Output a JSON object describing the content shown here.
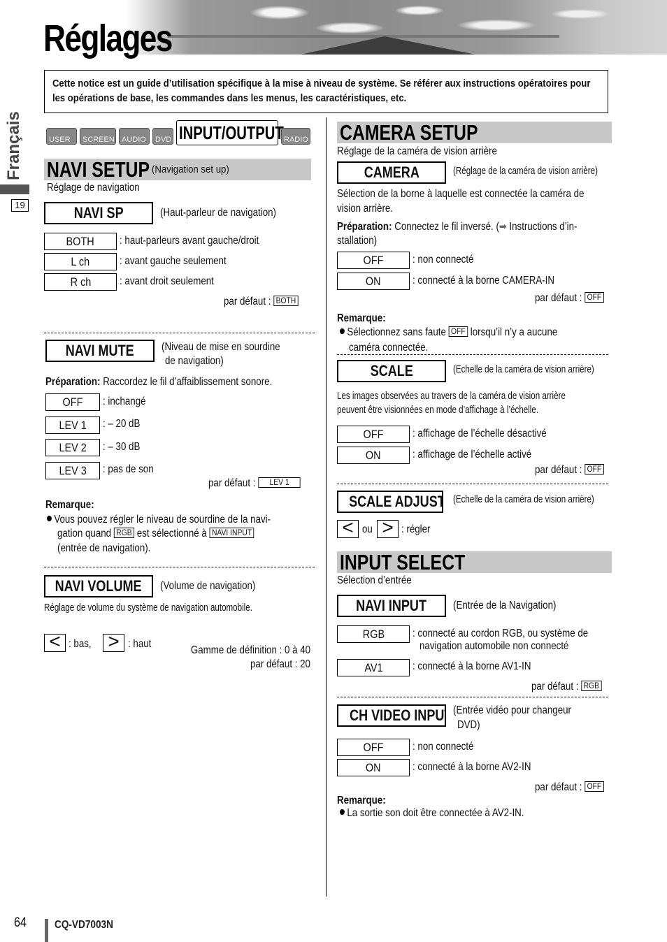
{
  "page": {
    "title": "Réglages",
    "intro": "Cette notice est un guide d’utilisation spécifique à la mise à niveau de système. Se référer aux instructions opératoires pour les opérations de base, les commandes dans les menus, les caractéristiques, etc.",
    "side_language": "Français",
    "side_number": "19",
    "page_number": "64",
    "model": "CQ-VD7003N"
  },
  "mode_tabs": [
    {
      "label": "USER",
      "active": false
    },
    {
      "label": "SCREEN",
      "active": false
    },
    {
      "label": "AUDIO",
      "active": false
    },
    {
      "label": "DVD",
      "active": false
    },
    {
      "label": "INPUT/OUTPUT",
      "active": true
    },
    {
      "label": "RADIO",
      "active": false
    }
  ],
  "navi_setup": {
    "title": "NAVI SETUP",
    "subtitle": "(Navigation set up)",
    "description": "Réglage de navigation",
    "navi_sp": {
      "label": "NAVI SP",
      "caption": "(Haut-parleur de navigation)",
      "options": [
        {
          "value": "BOTH",
          "desc": ": haut-parleurs avant gauche/droit"
        },
        {
          "value": "L ch",
          "desc": ": avant gauche seulement"
        },
        {
          "value": "R ch",
          "desc": ": avant droit seulement"
        }
      ],
      "default_label": "par défaut :",
      "default": "BOTH"
    },
    "navi_mute": {
      "label": "NAVI MUTE",
      "caption_1": "(Niveau de mise en sourdine",
      "caption_2": "de navigation)",
      "prep_label": "Préparation:",
      "prep_text": "Raccordez le fil d’affaiblissement sonore.",
      "options": [
        {
          "value": "OFF",
          "desc": ": inchangé"
        },
        {
          "value": "LEV 1",
          "desc": ": – 20 dB"
        },
        {
          "value": "LEV 2",
          "desc": ": – 30 dB"
        },
        {
          "value": "LEV 3",
          "desc": ": pas de son"
        }
      ],
      "default_label": "par défaut :",
      "default": "LEV 1",
      "remark_label": "Remarque:",
      "remark_1": "Vous pouvez régler le niveau de sourdine de la navi-",
      "remark_2a": "gation quand",
      "remark_tag_1": "RGB",
      "remark_2b": "est sélectionné à",
      "remark_tag_2": "NAVI INPUT",
      "remark_3": "(entrée de navigation)."
    },
    "navi_volume": {
      "label": "NAVI VOLUME",
      "caption": "(Volume de navigation)",
      "description": "Réglage de volume du système de navigation automobile.",
      "down_symbol": "<",
      "down_desc": ": bas,",
      "up_symbol": ">",
      "up_desc": ": haut",
      "range": "Gamme de définition : 0 à 40",
      "default": "par défaut : 20"
    }
  },
  "camera_setup": {
    "title": "CAMERA SETUP",
    "description": "Réglage de la caméra de vision arrière",
    "camera": {
      "label": "CAMERA",
      "caption": "(Réglage de la caméra de vision arrière)",
      "desc_1": "Sélection de la borne à laquelle est connectée la caméra de",
      "desc_2": "vision arrière.",
      "prep_label": "Préparation:",
      "prep_text_1": "Connectez le fil inversé. (",
      "prep_text_2": " Instructions d’in-",
      "prep_text_3": "stallation)",
      "options": [
        {
          "value": "OFF",
          "desc": ": non connecté"
        },
        {
          "value": "ON",
          "desc": ": connecté à la borne CAMERA-IN"
        }
      ],
      "default_label": "par défaut :",
      "default": "OFF",
      "remark_label": "Remarque:",
      "remark_1a": "Sélectionnez sans faute",
      "remark_tag": "OFF",
      "remark_1b": "lorsqu’il n’y a aucune",
      "remark_2": "caméra connectée."
    },
    "scale": {
      "label": "SCALE",
      "caption": "(Echelle de la caméra de vision arrière)",
      "desc_1": "Les images observées au travers de la caméra de vision arrière",
      "desc_2": "peuvent être visionnées en mode d’affichage à l’échelle.",
      "options": [
        {
          "value": "OFF",
          "desc": ": affichage de l’échelle désactivé"
        },
        {
          "value": "ON",
          "desc": ": affichage de l’échelle activé"
        }
      ],
      "default_label": "par défaut :",
      "default": "OFF"
    },
    "scale_adjust": {
      "label": "SCALE ADJUST",
      "caption": "(Echelle de la caméra de vision arrière)",
      "left_symbol": "<",
      "or_text": "ou",
      "right_symbol": ">",
      "action": ": régler"
    }
  },
  "input_select": {
    "title": "INPUT SELECT",
    "description": "Sélection d’entrée",
    "navi_input": {
      "label": "NAVI INPUT",
      "caption": "(Entrée de la Navigation)",
      "options": [
        {
          "value": "RGB",
          "desc_1": ": connecté au cordon RGB, ou système de",
          "desc_2": "navigation automobile non connecté"
        },
        {
          "value": "AV1",
          "desc_1": ": connecté à la borne AV1-IN",
          "desc_2": ""
        }
      ],
      "default_label": "par défaut :",
      "default": "RGB"
    },
    "ch_video_input": {
      "label": "CH VIDEO INPUT",
      "caption_1": "(Entrée vidéo pour changeur",
      "caption_2": "DVD)",
      "options": [
        {
          "value": "OFF",
          "desc": ": non connecté"
        },
        {
          "value": "ON",
          "desc": ": connecté à la borne AV2-IN"
        }
      ],
      "default_label": "par défaut :",
      "default": "OFF",
      "remark_label": "Remarque:",
      "remark": "La sortie son doit être connectée à AV2-IN."
    }
  }
}
